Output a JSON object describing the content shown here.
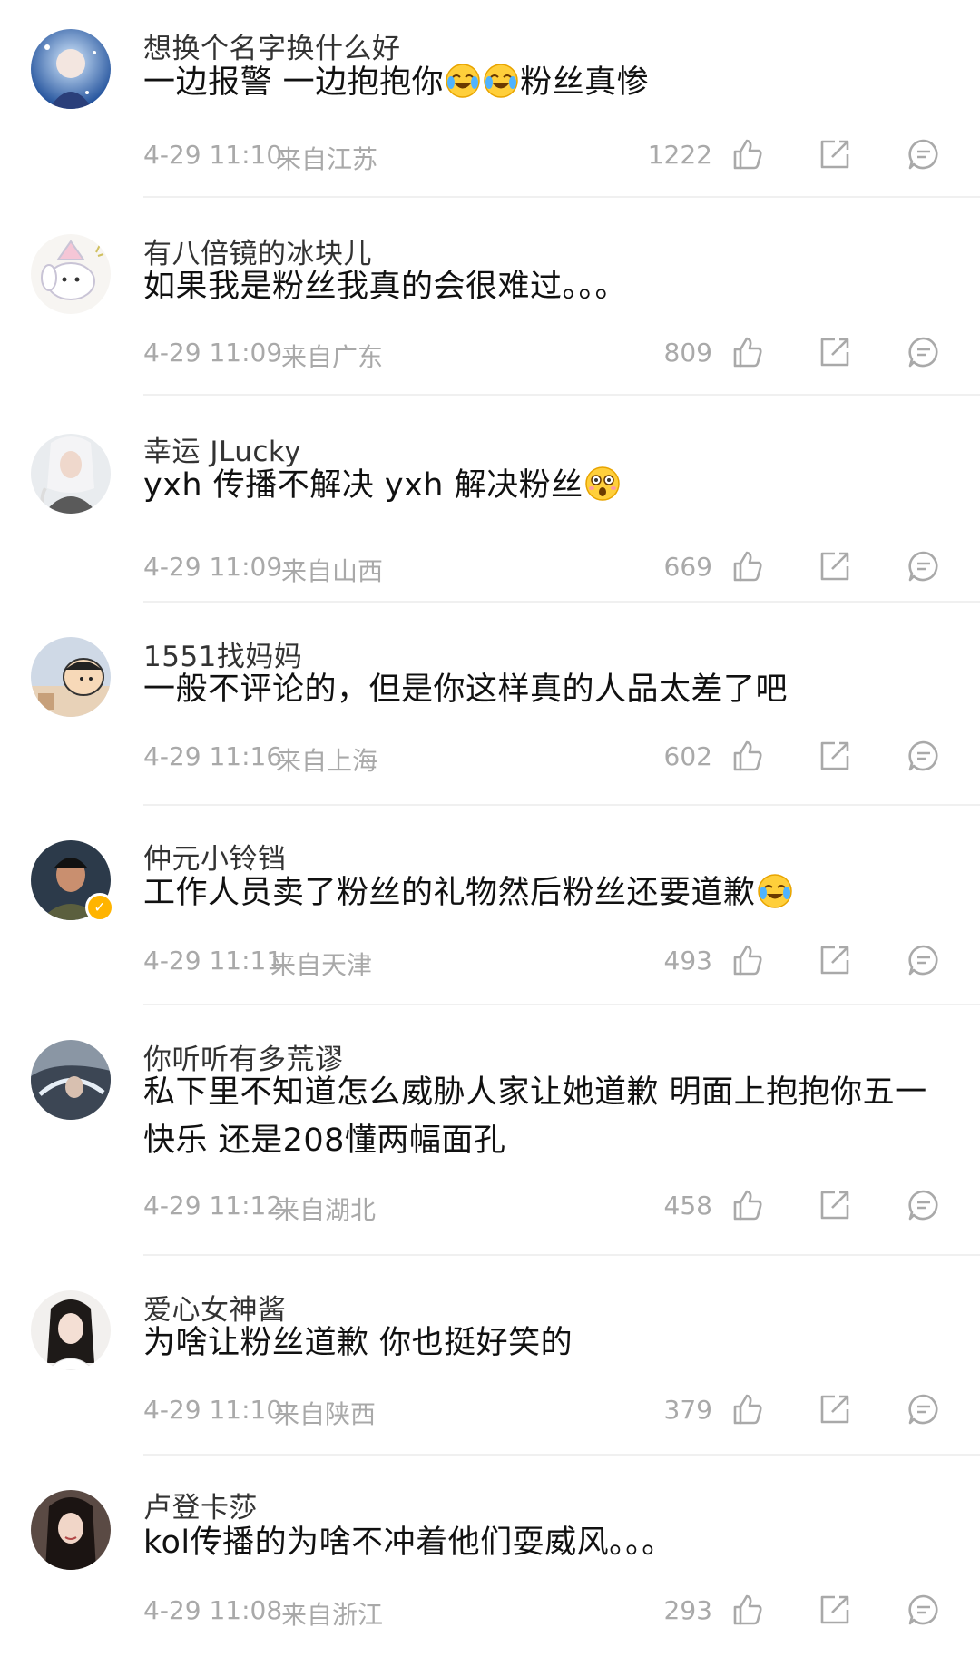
{
  "comments": [
    {
      "name": "想换个名字换什么好",
      "text": [
        "一边报警 一边抱抱你",
        "😭",
        "😭",
        "粉丝真惨"
      ],
      "time": "4-29 11:10",
      "location": "来自江苏",
      "likes": "1222"
    },
    {
      "name": "有八倍镜的冰块儿",
      "text": [
        "如果我是粉丝我真的会很难过。。。"
      ],
      "time": "4-29 11:09",
      "location": "来自广东",
      "likes": "809"
    },
    {
      "name": "幸运 JLucky",
      "text": [
        "yxh 传播不解决 yxh 解决粉丝",
        "😳"
      ],
      "time": "4-29 11:09",
      "location": "来自山西",
      "likes": "669"
    },
    {
      "name": "1551找妈妈",
      "text": [
        "一般不评论的，但是你这样真的人品太差了吧"
      ],
      "time": "4-29 11:16",
      "location": "来自上海",
      "likes": "602"
    },
    {
      "name": "仲元小铃铛",
      "text": [
        "工作人员卖了粉丝的礼物然后粉丝还要道歉",
        "😭"
      ],
      "time": "4-29 11:11",
      "location": "来自天津",
      "likes": "493"
    },
    {
      "name": "你听听有多荒谬",
      "text": [
        "私下里不知道怎么威胁人家让她道歉 明面上抱抱你五一快乐 还是208懂两幅面孔"
      ],
      "time": "4-29 11:12",
      "location": "来自湖北",
      "likes": "458"
    },
    {
      "name": "爱心女神酱",
      "text": [
        "为啥让粉丝道歉 你也挺好笑的"
      ],
      "time": "4-29 11:10",
      "location": "来自陕西",
      "likes": "379"
    },
    {
      "name": "卢登卡莎",
      "text": [
        "kol传播的为啥不冲着他们耍威风。。。"
      ],
      "time": "4-29 11:08",
      "location": "来自浙江",
      "likes": "293"
    }
  ],
  "icons": {
    "like": "thumbs-up-icon",
    "share": "share-icon",
    "reply": "comment-icon"
  },
  "colors": {
    "meta_text": "#a9a9a9",
    "name_text": "#333333",
    "body_text": "#111111",
    "verified_badge": "#ffb400"
  }
}
